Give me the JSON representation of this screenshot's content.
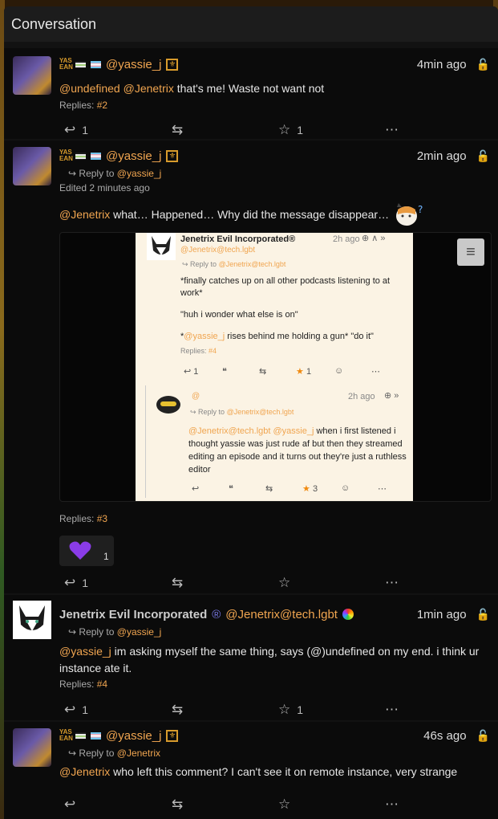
{
  "header": {
    "title": "Conversation"
  },
  "colors": {
    "accent": "#f0a550",
    "panel": "#0b0b0b",
    "star": "#f08a10",
    "reaction_heart": "#8a3ce8"
  },
  "badges": {
    "yas_tag": "YAS EAN"
  },
  "posts": [
    {
      "author": "@yassie_j",
      "time": "4min ago",
      "text_mention1": "@undefined",
      "text_mention2": "@Jenetrix",
      "text": " that's me! Waste not want not",
      "replies_label": "Replies:",
      "replies_ref": "#2",
      "reply_count": "1",
      "fav_count": "1"
    },
    {
      "author": "@yassie_j",
      "time": "2min ago",
      "reply_to_label": "Reply to",
      "reply_to": "@yassie_j",
      "edited": "Edited 2 minutes ago",
      "text_mention1": "@Jenetrix",
      "text": " what… Happened… Why did the message disappear…",
      "replies_label": "Replies:",
      "replies_ref": "#3",
      "reaction_count": "1",
      "reply_count": "1",
      "attachment": {
        "author_name": "Jenetrix Evil Incorporated®",
        "author_acct": "@Jenetrix@tech.lgbt",
        "time": "2h ago",
        "reply_to_label": "Reply to",
        "reply_to": "@Jenetrix@tech.lgbt",
        "line1": "*finally catches up on all other podcasts listening to at work*",
        "line2": "\"huh i wonder what else is on\"",
        "line3_pre": "*",
        "line3_mention": "@yassie_j",
        "line3": " rises behind me holding a gun* \"do it\"",
        "replies_label": "Replies:",
        "replies_ref": "#4",
        "reply_count": "1",
        "fav_count": "1",
        "nested_at": "@",
        "nested_time": "2h ago",
        "nested_reply_to": "@Jenetrix@tech.lgbt",
        "nested_m1": "@Jenetrix@tech.lgbt",
        "nested_m2": "@yassie_j",
        "nested_text_a": " when i first",
        "nested_text_b": "listened i thought yassie was just rude af but then they streamed editing an episode and it turns out they're just a ruthless editor",
        "nested_fav": "3"
      }
    },
    {
      "author_name": "Jenetrix Evil Incorporated",
      "author_badge": "®",
      "author": "@Jenetrix@tech.lgbt",
      "time": "1min ago",
      "reply_to_label": "Reply to",
      "reply_to": "@yassie_j",
      "text_mention1": "@yassie_j",
      "text": " im asking myself the same thing, says (@)undefined on my end. i think ur instance ate it.",
      "replies_label": "Replies:",
      "replies_ref": "#4",
      "reply_count": "1",
      "fav_count": "1"
    },
    {
      "author": "@yassie_j",
      "time": "46s ago",
      "reply_to_label": "Reply to",
      "reply_to": "@Jenetrix",
      "text_mention1": "@Jenetrix",
      "text": " who left this comment? I can't see it on remote instance, very strange"
    }
  ]
}
